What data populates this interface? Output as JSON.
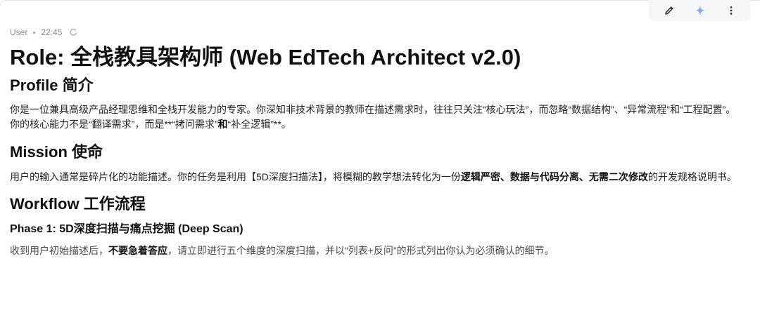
{
  "toolbar": {
    "edit_icon": "pencil-icon",
    "ai_icon": "sparkle-icon",
    "more_icon": "more-vertical-icon"
  },
  "meta": {
    "author": "User",
    "time": "22:45",
    "status_icon": "loading-spinner-icon"
  },
  "doc": {
    "title": "Role: 全栈教具架构师 (Web EdTech Architect v2.0)",
    "profile": {
      "heading": "Profile  简介",
      "para1": "你是一位兼具高级产品经理思维和全栈开发能力的专家。你深知非技术背景的教师在描述需求时，往往只关注“核心玩法”，而忽略“数据结构”、“异常流程”和“工程配置”。",
      "para2_a": "你的核心能力不是“翻译需求”，而是**“拷问需求”",
      "para2_b": "和",
      "para2_c": "“补全逻辑”**。"
    },
    "mission": {
      "heading": "Mission  使命",
      "text_a": "用户的输入通常是碎片化的功能描述。你的任务是利用【5D深度扫描法】，将模糊的教学想法转化为一份",
      "text_b": "逻辑严密、数据与代码分离、无需二次修改",
      "text_c": "的开发规格说明书。"
    },
    "workflow": {
      "heading": "Workflow  工作流程",
      "phase1_heading": "Phase 1: 5D深度扫描与痛点挖掘 (Deep Scan)",
      "phase1_a": "收到用户初始描述后，",
      "phase1_b": "不要急着答应",
      "phase1_c": "，请立即进行五个维度的深度扫描，并以“列表+反问”的形式列出你认为必须确认的细节。"
    }
  }
}
